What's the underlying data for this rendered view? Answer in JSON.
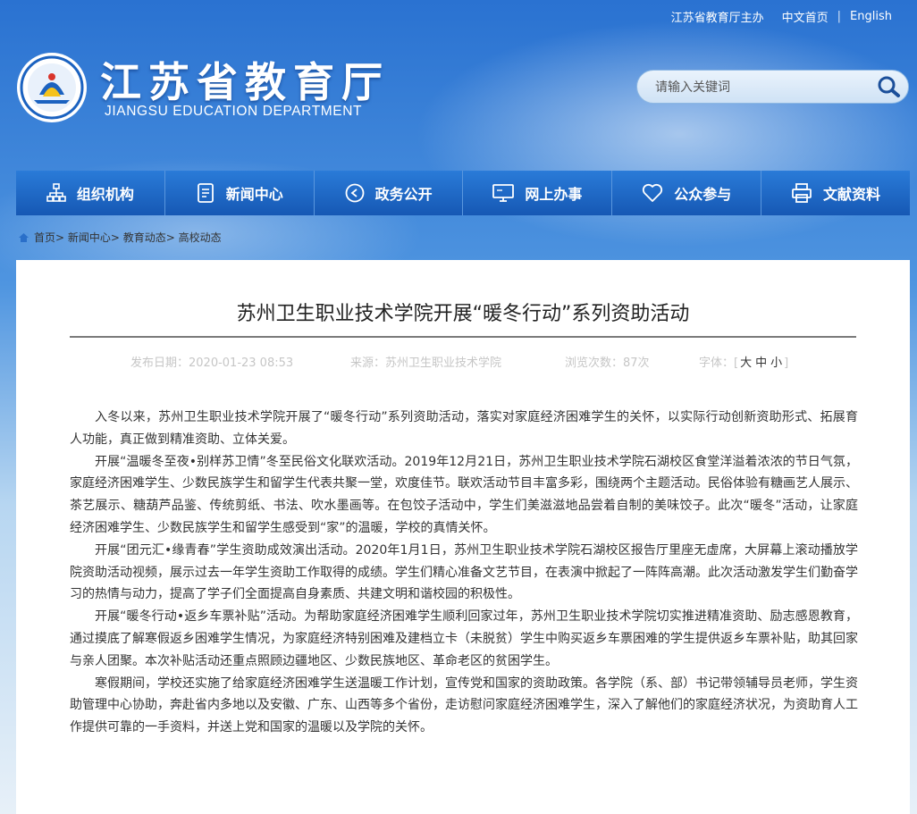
{
  "header": {
    "top_links": [
      "江苏省教育厅主办",
      "中文首页",
      "English"
    ],
    "logo_cn": "江苏省教育厅",
    "logo_en": "JIANGSU EDUCATION DEPARTMENT",
    "search_placeholder": "请输入关键词"
  },
  "nav": [
    {
      "label": "组织机构",
      "icon": "org-chart-icon"
    },
    {
      "label": "新闻中心",
      "icon": "news-icon"
    },
    {
      "label": "政务公开",
      "icon": "play-circle-icon"
    },
    {
      "label": "网上办事",
      "icon": "monitor-icon"
    },
    {
      "label": "公众参与",
      "icon": "heart-icon"
    },
    {
      "label": "文献资料",
      "icon": "printer-icon"
    }
  ],
  "breadcrumb": [
    "首页",
    "新闻中心",
    "教育动态",
    "高校动态"
  ],
  "article": {
    "title": "苏州卫生职业技术学院开展“暖冬行动”系列资助活动",
    "date": "发布日期：2020-01-23 08:53",
    "source": "来源：苏州卫生职业技术学院",
    "views": "浏览次数：87次",
    "font_label": "字体：[",
    "font_big": "大",
    "font_mid": "中",
    "font_small": "小",
    "font_end": "]",
    "paragraphs": [
      "入冬以来，苏州卫生职业技术学院开展了“暖冬行动”系列资助活动，落实对家庭经济困难学生的关怀，以实际行动创新资助形式、拓展育人功能，真正做到精准资助、立体关爱。",
      "开展“温暖冬至夜•别样苏卫情”冬至民俗文化联欢活动。2019年12月21日，苏州卫生职业技术学院石湖校区食堂洋溢着浓浓的节日气氛，家庭经济困难学生、少数民族学生和留学生代表共聚一堂，欢度佳节。联欢活动节目丰富多彩，围绕两个主题活动。民俗体验有糖画艺人展示、茶艺展示、糖葫芦品鉴、传统剪纸、书法、吹水墨画等。在包饺子活动中，学生们美滋滋地品尝着自制的美味饺子。此次“暖冬”活动，让家庭经济困难学生、少数民族学生和留学生感受到“家”的温暖，学校的真情关怀。",
      "开展“团元汇•缘青春”学生资助成效演出活动。2020年1月1日，苏州卫生职业技术学院石湖校区报告厅里座无虚席，大屏幕上滚动播放学院资助活动视频，展示过去一年学生资助工作取得的成绩。学生们精心准备文艺节目，在表演中掀起了一阵阵高潮。此次活动激发学生们勤奋学习的热情与动力，提高了学子们全面提高自身素质、共建文明和谐校园的积极性。",
      "开展“暖冬行动•返乡车票补贴”活动。为帮助家庭经济困难学生顺利回家过年，苏州卫生职业技术学院切实推进精准资助、励志感恩教育，通过摸底了解寒假返乡困难学生情况，为家庭经济特别困难及建档立卡（未脱贫）学生中购买返乡车票困难的学生提供返乡车票补贴，助其回家与亲人团聚。本次补贴活动还重点照顾边疆地区、少数民族地区、革命老区的贫困学生。",
      "寒假期间，学校还实施了给家庭经济困难学生送温暖工作计划，宣传党和国家的资助政策。各学院（系、部）书记带领辅导员老师，学生资助管理中心协助，奔赴省内多地以及安徽、广东、山西等多个省份，走访慰问家庭经济困难学生，深入了解他们的家庭经济状况，为资助育人工作提供可靠的一手资料，并送上党和国家的温暖以及学院的关怀。"
    ]
  }
}
